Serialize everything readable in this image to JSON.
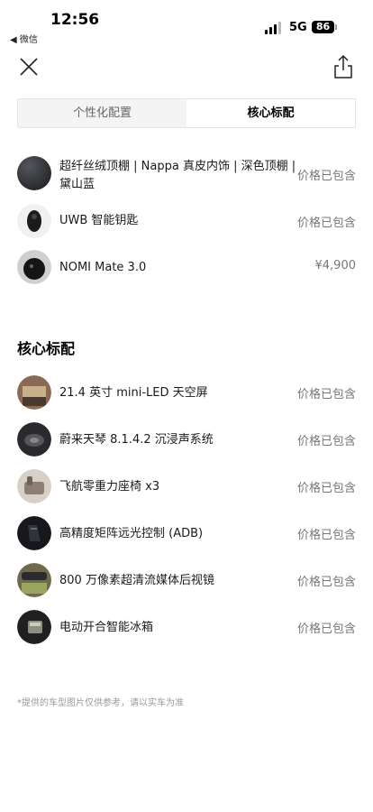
{
  "status_bar": {
    "time": "12:56",
    "back_app": "◀ 微信",
    "network": "5G",
    "battery": "86"
  },
  "tabs": [
    {
      "label": "个性化配置",
      "active": false
    },
    {
      "label": "核心标配",
      "active": true
    }
  ],
  "selected_items": [
    {
      "name_line1": "超纤丝绒顶棚 | Nappa 真皮内饰 | 深色顶棚 |",
      "name_line2": "黛山蓝",
      "price": "价格已包含",
      "icon": "interior-swatch"
    },
    {
      "name_line1": "UWB 智能钥匙",
      "name_line2": "",
      "price": "价格已包含",
      "icon": "smart-key"
    },
    {
      "name_line1": "NOMI Mate 3.0",
      "name_line2": "",
      "price": "¥4,900",
      "icon": "nomi-device"
    }
  ],
  "core_section": {
    "title": "核心标配",
    "items": [
      {
        "name": "21.4 英寸 mini-LED 天空屏",
        "price": "价格已包含",
        "icon": "sky-screen"
      },
      {
        "name": "蔚来天琴 8.1.4.2 沉浸声系统",
        "price": "价格已包含",
        "icon": "speaker"
      },
      {
        "name": "飞航零重力座椅 x3",
        "price": "价格已包含",
        "icon": "seat"
      },
      {
        "name": "高精度矩阵远光控制 (ADB)",
        "price": "价格已包含",
        "icon": "headlight"
      },
      {
        "name": "800 万像素超清流媒体后视镜",
        "price": "价格已包含",
        "icon": "rearview-mirror"
      },
      {
        "name": "电动开合智能冰箱",
        "price": "价格已包含",
        "icon": "fridge"
      }
    ]
  },
  "footnote": "*提供的车型图片仅供参考，请以实车为准"
}
